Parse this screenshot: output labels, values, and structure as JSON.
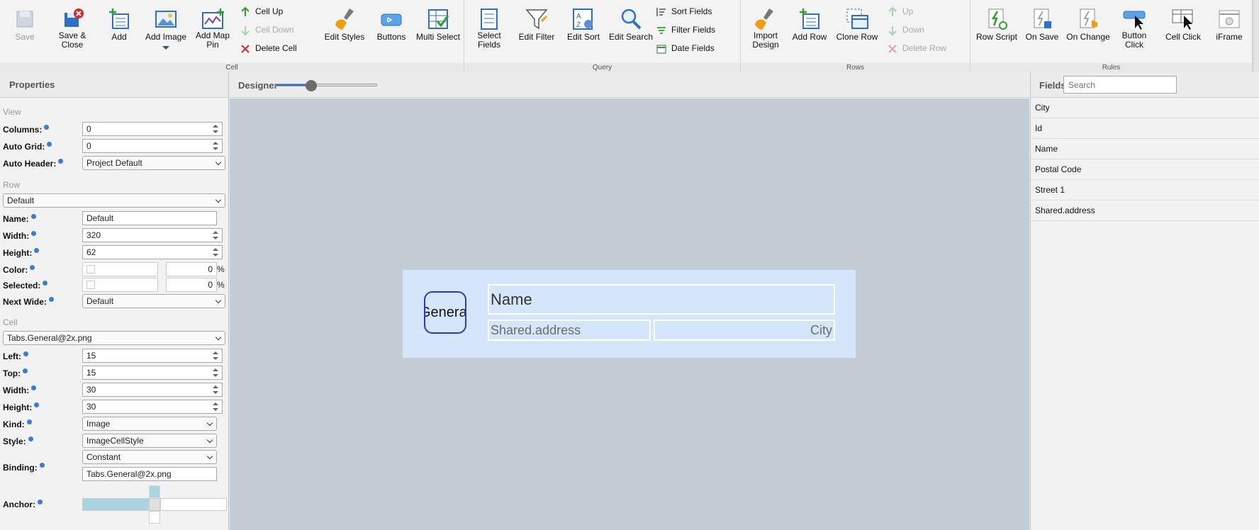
{
  "ribbon": {
    "groups": {
      "cell": "Cell",
      "query": "Query",
      "rows": "Rows",
      "rules": "Rules"
    },
    "buttons": {
      "save": "Save",
      "save_close": "Save &\nClose",
      "add": "Add",
      "add_image": "Add Image",
      "add_map_pin": "Add Map\nPin",
      "cell_up": "Cell Up",
      "cell_down": "Cell Down",
      "delete_cell": "Delete Cell",
      "edit_styles": "Edit Styles",
      "buttons": "Buttons",
      "multi_select": "Multi Select",
      "select_fields": "Select\nFields",
      "edit_filter": "Edit Filter",
      "edit_sort": "Edit Sort",
      "edit_search": "Edit Search",
      "sort_fields": "Sort Fields",
      "filter_fields": "Filter Fields",
      "date_fields": "Date Fields",
      "import_design": "Import\nDesign",
      "add_row": "Add Row",
      "clone_row": "Clone Row",
      "up": "Up",
      "down": "Down",
      "delete_row": "Delete Row",
      "row_script": "Row Script",
      "on_save": "On Save",
      "on_change": "On Change",
      "button_click": "Button\nClick",
      "cell_click": "Cell Click",
      "iframe": "iFrame"
    }
  },
  "properties": {
    "title": "Properties",
    "view_section": "View",
    "columns_label": "Columns:",
    "columns_value": "0",
    "auto_grid_label": "Auto Grid:",
    "auto_grid_value": "0",
    "auto_header_label": "Auto Header:",
    "auto_header_value": "Project Default",
    "row_section": "Row",
    "row_select": "Default",
    "name_label": "Name:",
    "name_value": "Default",
    "width_label": "Width:",
    "width_value": "320",
    "height_label": "Height:",
    "height_value": "62",
    "color_label": "Color:",
    "color_pct": "0",
    "selected_label": "Selected:",
    "selected_pct": "0",
    "pct_sign": "%",
    "next_wide_label": "Next Wide:",
    "next_wide_value": "Default",
    "cell_section": "Cell",
    "cell_select": "Tabs.General@2x.png",
    "left_label": "Left:",
    "left_value": "15",
    "top_label": "Top:",
    "top_value": "15",
    "cell_width_label": "Width:",
    "cell_width_value": "30",
    "cell_height_label": "Height:",
    "cell_height_value": "30",
    "kind_label": "Kind:",
    "kind_value": "Image",
    "style_label": "Style:",
    "style_value": "ImageCellStyle",
    "binding_label": "Binding:",
    "binding_type": "Constant",
    "binding_value": "Tabs.General@2x.png",
    "anchor_label": "Anchor:"
  },
  "designer": {
    "title": "Designer",
    "zoom_fraction": 0.35,
    "image_cell_text": "General@",
    "name_cell": "Name",
    "address_cell": "Shared.address",
    "city_cell": "City"
  },
  "fields": {
    "title": "Fields",
    "search_placeholder": "Search",
    "items": [
      "City",
      "Id",
      "Name",
      "Postal Code",
      "Street 1",
      "Shared.address"
    ]
  }
}
